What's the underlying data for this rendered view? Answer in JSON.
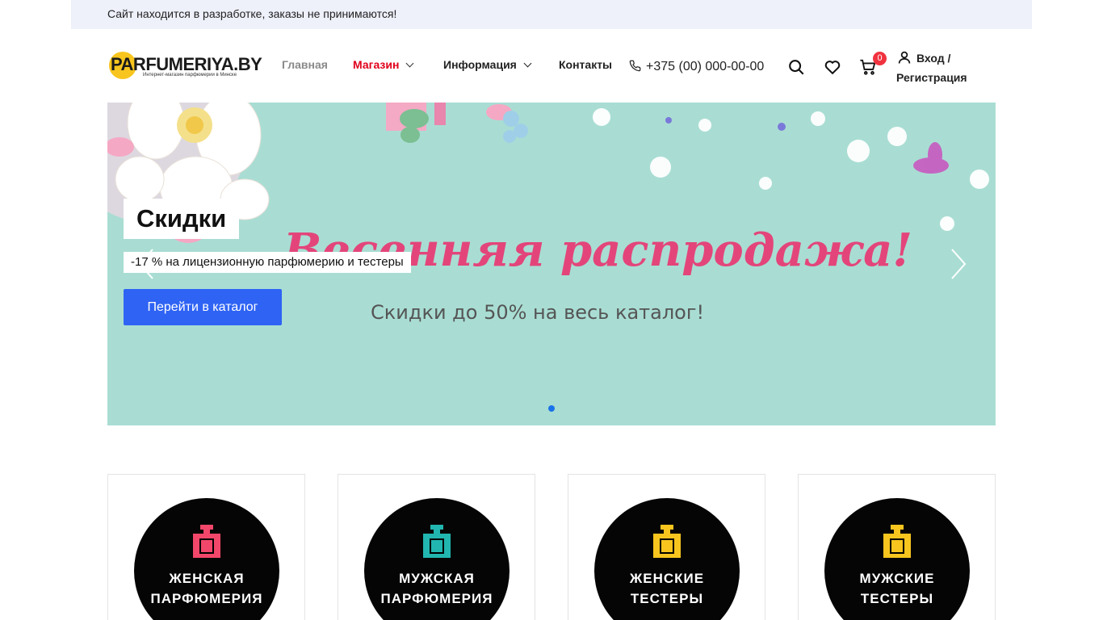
{
  "notice": {
    "text": "Сайт находится в разработке, заказы не принимаются!"
  },
  "header": {
    "logo": {
      "text": "PARFUMERIYA.BY",
      "tagline": "Интернет-магазин парфюмерии в Минске"
    },
    "nav": [
      {
        "label": "Главная",
        "state": "inactive"
      },
      {
        "label": "Магазин",
        "state": "active",
        "dropdown": true
      },
      {
        "label": "Информация",
        "dropdown": true
      },
      {
        "label": "Контакты"
      }
    ],
    "phone": "+375 (00) 000-00-00",
    "icons": [
      "search-icon",
      "heart-icon",
      "cart-icon",
      "user-icon"
    ],
    "cart_count": "0",
    "login": {
      "line1": "Вход /",
      "line2": "Регистрация"
    }
  },
  "hero": {
    "title": "Скидки",
    "text": "-17 % на лицензионную парфюмерию и тестеры",
    "button": "Перейти в каталог",
    "image_text": {
      "headline": "Весенняя распродажа!",
      "subline": "Скидки до 50% на весь каталог!"
    },
    "slides_total": 1,
    "active_slide": 1
  },
  "categories": [
    {
      "line1": "ЖЕНСКАЯ",
      "line2": "ПАРФЮМЕРИЯ",
      "bottle_color": "#f2476a"
    },
    {
      "line1": "МУЖСКАЯ",
      "line2": "ПАРФЮМЕРИЯ",
      "bottle_color": "#22b6b0"
    },
    {
      "line1": "ЖЕНСКИЕ",
      "line2": "ТЕСТЕРЫ",
      "bottle_color": "#f7c51e"
    },
    {
      "line1": "МУЖСКИЕ",
      "line2": "ТЕСТЕРЫ",
      "bottle_color": "#f7c51e"
    }
  ],
  "colors": {
    "accent": "#e0001b",
    "button": "#2e63f4",
    "badge": "#f0333f",
    "notice_bg": "#eef0fa",
    "hero_bg": "#a9ddd3"
  }
}
